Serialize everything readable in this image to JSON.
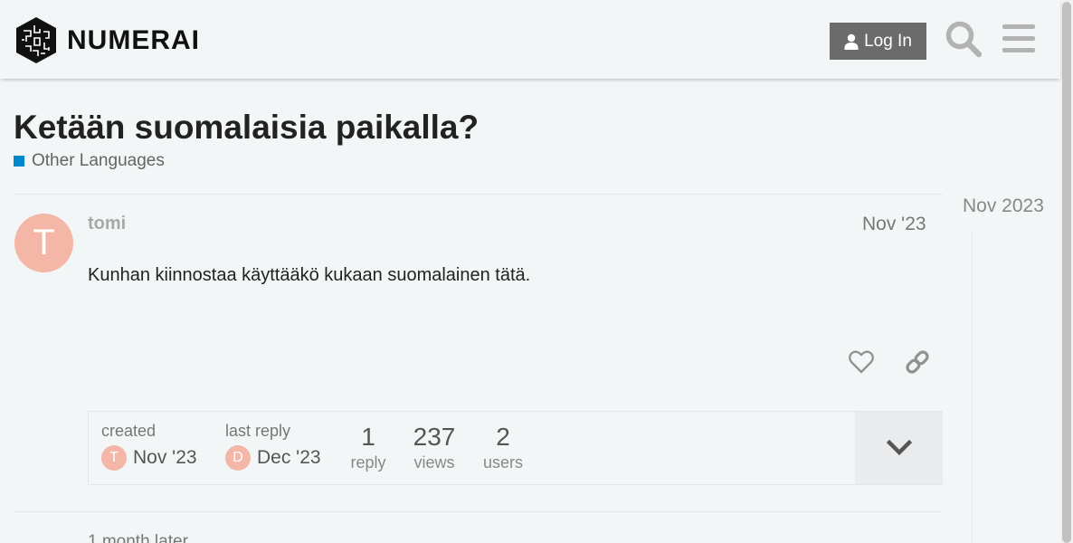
{
  "header": {
    "logo_text": "NUMERAI",
    "login_label": "Log In",
    "icons": {
      "search": "search-icon",
      "menu": "hamburger-menu-icon",
      "user": "user-icon"
    }
  },
  "topic": {
    "title": "Ketään suomalaisia paikalla?",
    "category": "Other Languages",
    "category_color": "#0088cc"
  },
  "post": {
    "avatar_letter": "T",
    "avatar_color": "#f4b7a7",
    "username": "tomi",
    "date": "Nov '23",
    "body": "Kunhan kiinnostaa käyttääkö kukaan suomalainen tätä."
  },
  "topic_map": {
    "created_label": "created",
    "created_avatar": "T",
    "created_date": "Nov '23",
    "last_reply_label": "last reply",
    "last_reply_avatar": "D",
    "last_reply_date": "Dec '23",
    "replies_count": "1",
    "replies_label": "reply",
    "views_count": "237",
    "views_label": "views",
    "users_count": "2",
    "users_label": "users"
  },
  "timeline": {
    "date": "Nov 2023"
  },
  "next": {
    "small_action": "1 month later"
  }
}
